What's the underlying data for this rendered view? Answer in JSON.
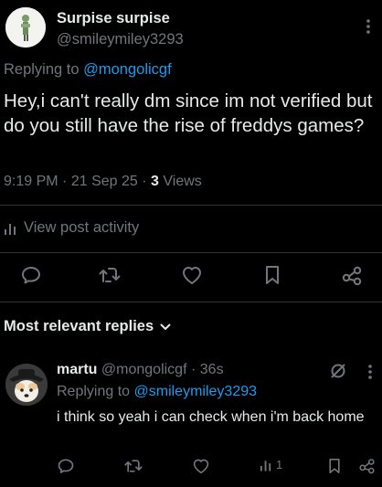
{
  "post": {
    "display_name": "Surpise surpise",
    "handle": "@smileymiley3293",
    "replying_prefix": "Replying to ",
    "replying_to": "@mongolicgf",
    "text": "Hey,i can't really dm since im not verified but do you still have the rise of freddys games?",
    "time": "9:19 PM",
    "date": "21 Sep 25",
    "views_count": "3",
    "views_label": "Views",
    "activity_label": "View post activity"
  },
  "replies_header": {
    "sort_label": "Most relevant replies"
  },
  "reply": {
    "display_name": "martu",
    "handle": "@mongolicgf",
    "time": "36s",
    "replying_prefix": "Replying to ",
    "replying_to": "@smileymiley3293",
    "text": "i think so yeah i can check when i'm back home",
    "views_count": "1"
  },
  "colors": {
    "background": "#000000",
    "text": "#e7e9ea",
    "muted": "#71767b",
    "link": "#1d9bf0",
    "divider": "#2f3336"
  },
  "icons": [
    "reply-icon",
    "repost-icon",
    "like-icon",
    "bookmark-icon",
    "share-icon",
    "more-icon",
    "grok-icon",
    "views-icon",
    "chevron-down-icon"
  ]
}
